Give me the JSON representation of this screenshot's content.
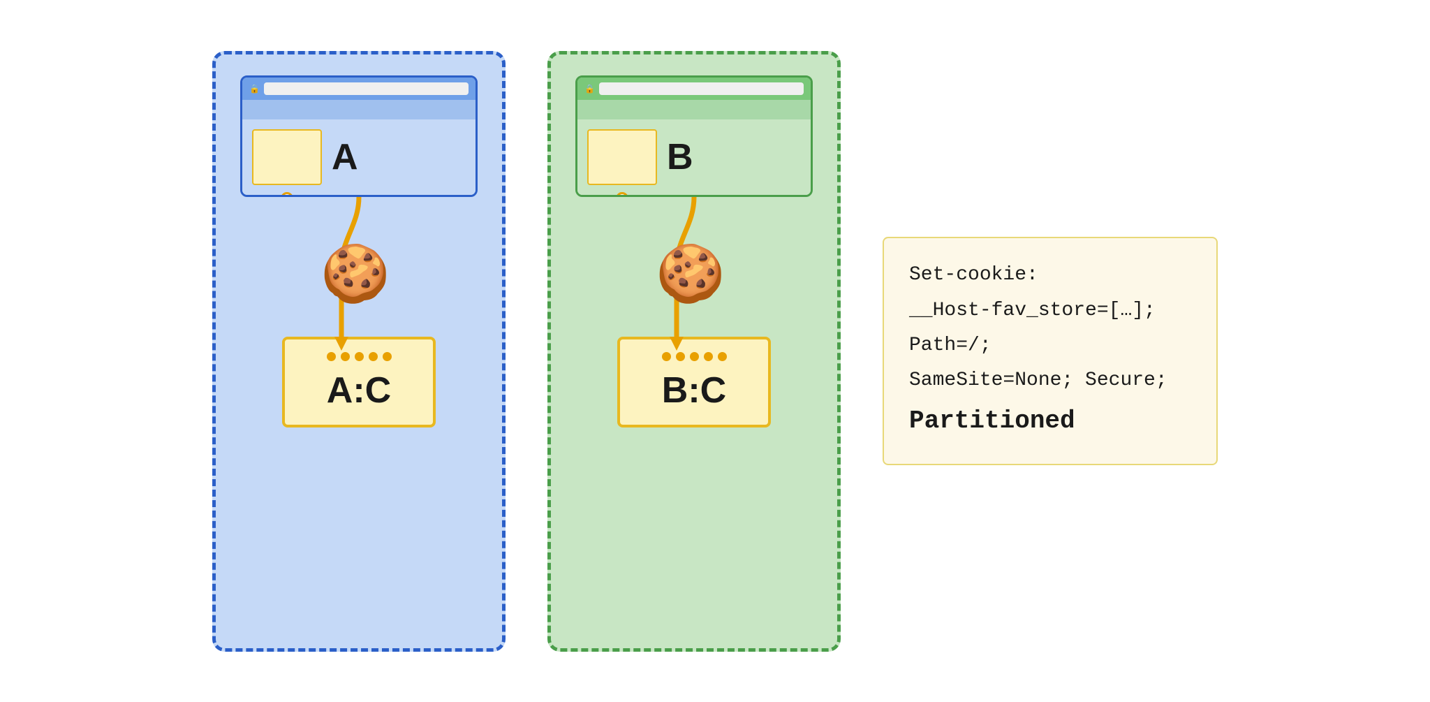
{
  "scene": {
    "partition_a": {
      "label": "A",
      "storage_label": "A:C",
      "border_color": "#2b5fc8",
      "bg_color": "#c5d9f7",
      "toolbar_color": "#6fa0e8",
      "tab_color": "#a0c0ee"
    },
    "partition_b": {
      "label": "B",
      "storage_label": "B:C",
      "border_color": "#4a9e4a",
      "bg_color": "#c8e6c4",
      "toolbar_color": "#7ac87a",
      "tab_color": "#a8d8a8"
    },
    "code_box": {
      "lines": [
        "Set-cookie:",
        "__Host-fav_store=[…];",
        "Path=/;",
        "SameSite=None; Secure;",
        "Partitioned"
      ]
    }
  }
}
